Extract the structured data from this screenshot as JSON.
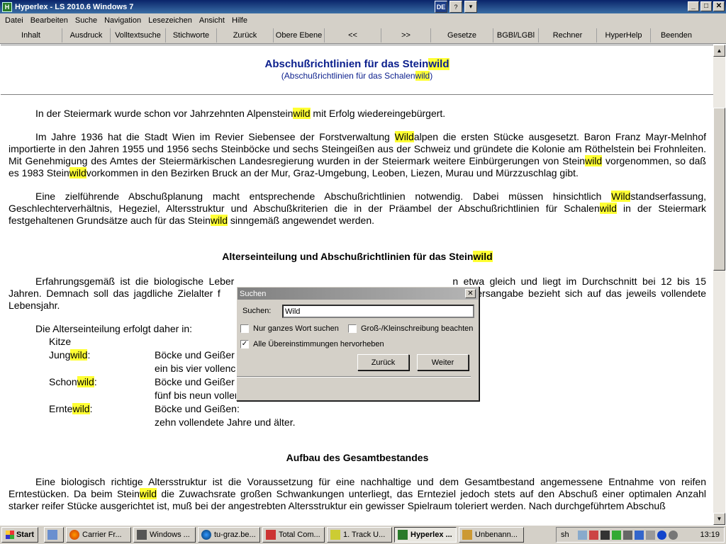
{
  "window": {
    "title": "Hyperlex - LS 2010.6 Windows 7",
    "lang_badge": "DE",
    "help_icon": "help-icon",
    "menu_icon": "chevron-down-icon"
  },
  "menu": [
    "Datei",
    "Bearbeiten",
    "Suche",
    "Navigation",
    "Lesezeichen",
    "Ansicht",
    "Hilfe"
  ],
  "toolbar": [
    "Inhalt",
    "Ausdruck",
    "Volltextsuche",
    "Stichworte",
    "Zurück",
    "Obere Ebene",
    "<<",
    ">>",
    "Gesetze",
    "BGBl/LGBl",
    "Rechner",
    "HyperHelp",
    "Beenden"
  ],
  "document": {
    "title_pre": "Abschußrichtlinien für das Stein",
    "title_hl": "wild",
    "subtitle_pre": "(Abschußrichtlinien für das Schalen",
    "subtitle_hl": "wild",
    "subtitle_post": ")",
    "p1_a": "In der Steiermark wurde schon vor Jahrzehnten Alpenstein",
    "p1_hl": "wild",
    "p1_b": " mit Erfolg wiedereingebürgert.",
    "p2_a": "Im Jahre 1936 hat die Stadt Wien im Revier Siebensee der Forstverwaltung ",
    "p2_hl1": "Wild",
    "p2_b": "alpen die ersten Stücke ausgesetzt. Baron Franz Mayr-Melnhof importierte in den Jahren 1955 und 1956 sechs Steinböcke und sechs Steingeißen aus der Schweiz und gründete die Kolonie am Röthelstein bei Frohnleiten. Mit Genehmigung des Amtes der Steiermärkischen Landesregierung wurden in der Steiermark weitere Einbürgerungen von Stein",
    "p2_hl2": "wild",
    "p2_c": " vorgenommen, so daß es 1983 Stein",
    "p2_hl3": "wild",
    "p2_d": "vorkommen in den Bezirken Bruck an der Mur, Graz-Umgebung, Leoben, Liezen, Murau und Mürzzuschlag gibt.",
    "p3_a": "Eine zielführende Abschußplanung macht entsprechende Abschußrichtlinien notwendig. Dabei müssen hinsichtlich ",
    "p3_hl1": "Wild",
    "p3_b": "standserfassung, Geschlechterverhältnis, Hegeziel, Altersstruktur und Abschußkriterien die in der Präambel der Abschußrichtlinien für Schalen",
    "p3_hl2": "wild",
    "p3_c": " in der Steiermark festgehaltenen Grundsätze auch für das Stein",
    "p3_hl3": "wild",
    "p3_d": " sinngemäß angewendet werden.",
    "sec1_pre": "Alterseinteilung und Abschußrichtlinien für das Stein",
    "sec1_hl": "wild",
    "p4_a": "Erfahrungsgemäß ist die biologische Leber",
    "p4_b": "n etwa gleich und liegt im Durchschnitt bei 12 bis 15 Jahren. Demnach soll das jagdliche Zielalter f",
    "p4_c": "n. Die Altersangabe bezieht sich auf das jeweils vollendete Lebensjahr.",
    "p5": "Die Alterseinteilung erfolgt daher in:",
    "kitze": "Kitze",
    "l1_pre": "Jung",
    "l1_hl": "wild",
    "l1_post": ":",
    "l1_v1": "Böcke und Geißer",
    "l1_v2": "ein bis vier vollenc",
    "l2_pre": "Schon",
    "l2_hl": "wild",
    "l2_post": ":",
    "l2_v1": "Böcke und Geißer",
    "l2_v2": "fünf bis neun vollendete Jahre",
    "l3_pre": "Ernte",
    "l3_hl": "wild",
    "l3_post": ":",
    "l3_v1": "Böcke und Geißen:",
    "l3_v2": "zehn vollendete Jahre und älter.",
    "sec2": "Aufbau des Gesamtbestandes",
    "p6_a": "Eine biologisch richtige Altersstruktur ist die Voraussetzung für eine nachhaltige und dem Gesamtbestand angemessene Entnahme von reifen Erntestücken. Da beim Stein",
    "p6_hl": "wild",
    "p6_b": " die Zuwachsrate großen Schwankungen unterliegt, das Ernteziel jedoch stets auf den Abschuß einer optimalen Anzahl starker reifer Stücke ausgerichtet ist, muß bei der angestrebten Altersstruktur ein gewisser Spielraum toleriert werden. Nach durchgeführtem Abschuß"
  },
  "dialog": {
    "title": "Suchen",
    "search_label": "Suchen:",
    "search_value": "Wild",
    "opt_whole_word": "Nur ganzes Wort suchen",
    "opt_case": "Groß-/Kleinschreibung beachten",
    "opt_highlight": "Alle Übereinstimmungen hervorheben",
    "btn_back": "Zurück",
    "btn_next": "Weiter"
  },
  "taskbar": {
    "start": "Start",
    "tasks": [
      "Carrier Fr...",
      "Windows ...",
      "tu-graz.be...",
      "Total Com...",
      "1. Track U...",
      "Hyperlex ...",
      "Unbenann..."
    ],
    "lang": "sh",
    "clock": "13:19"
  },
  "colors": {
    "highlight": "#ffff33",
    "title_blue": "#0a1e8c"
  }
}
